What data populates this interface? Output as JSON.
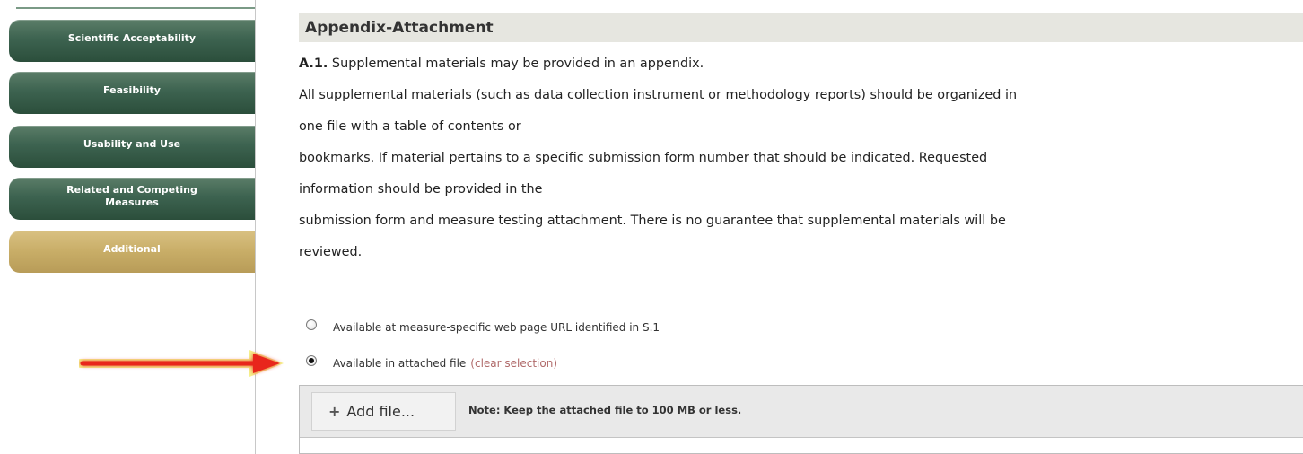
{
  "sidebar": {
    "items": [
      {
        "label": "Scientific Acceptability"
      },
      {
        "label": "Feasibility"
      },
      {
        "label": "Usability and Use"
      },
      {
        "label": "Related and Competing Measures"
      },
      {
        "label": "Additional"
      }
    ],
    "active_item": "Additional"
  },
  "section": {
    "title": "Appendix-Attachment",
    "question_number": "A.1.",
    "question_text": " Supplemental materials may be provided in an appendix.",
    "instructions": [
      "All supplemental materials (such as data collection instrument or methodology reports) should be organized in",
      "one file with a table of contents or",
      "bookmarks. If material pertains to a specific submission form number that should be indicated. Requested",
      "information should be provided in the",
      "submission form and measure testing attachment. There is no guarantee that supplemental materials will be",
      "reviewed."
    ]
  },
  "options": {
    "option1": {
      "label": "Available at measure-specific web page URL identified in S.1",
      "selected": false
    },
    "option2": {
      "label": "Available in attached file",
      "selected": true
    },
    "clear_label": "(clear selection)"
  },
  "upload": {
    "add_file_label": "Add file...",
    "note": "Note: Keep the attached file to 100 MB or less."
  },
  "annotation": {
    "arrow_color": "#e8271b",
    "arrow_glow": "#f4f07a"
  },
  "colors": {
    "nav_green": "#3d6350",
    "nav_active_gold": "#c8ad67",
    "header_bg": "#e6e6e0",
    "link_color": "#b06a6a"
  }
}
